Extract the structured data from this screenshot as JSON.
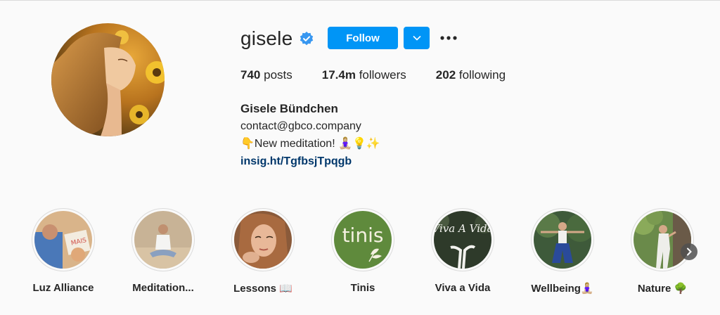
{
  "profile": {
    "username": "gisele",
    "verified_icon": "verified-badge-icon",
    "follow_label": "Follow",
    "accent_color": "#0095f6",
    "stats": {
      "posts_count": "740",
      "posts_label": "posts",
      "followers_count": "17.4m",
      "followers_label": "followers",
      "following_count": "202",
      "following_label": "following"
    },
    "bio": {
      "full_name": "Gisele Bündchen",
      "line1": "contact@gbco.company",
      "line2": "👇New meditation! 🧘🏼‍♀️💡✨",
      "link": "insig.ht/TgfbsjTpqgb"
    }
  },
  "highlights": [
    {
      "label": "Luz Alliance"
    },
    {
      "label": "Meditation..."
    },
    {
      "label": "Lessons 📖"
    },
    {
      "label": "Tinis",
      "cover_text": "tinis"
    },
    {
      "label": "Viva a Vida",
      "cover_text": "Viva A Vida"
    },
    {
      "label": "Wellbeing🧘🏼‍♀️"
    },
    {
      "label": "Nature 🌳"
    }
  ]
}
